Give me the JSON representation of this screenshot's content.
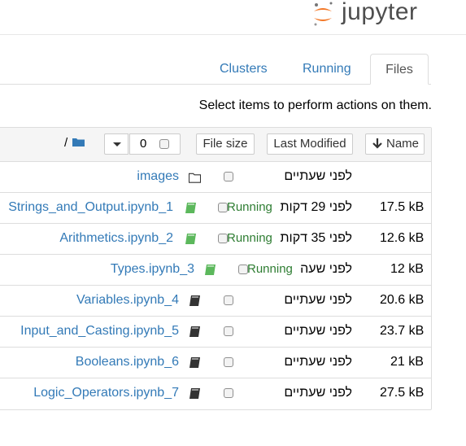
{
  "logo": {
    "text": "jupyter"
  },
  "tabs": {
    "clusters": "Clusters",
    "running": "Running",
    "files": "Files"
  },
  "instructions": "Select items to perform actions on them.",
  "header": {
    "name_label": "Name",
    "modified_label": "Last Modified",
    "size_label": "File size",
    "selected_count": "0",
    "breadcrumb": "/"
  },
  "rows": [
    {
      "name": "images",
      "type": "folder",
      "modified": "לפני שעתיים",
      "size": "",
      "running": ""
    },
    {
      "name": "Strings_and_Output.ipynb_1",
      "type": "notebook-running",
      "modified": "לפני 29 דקות",
      "size": "17.5 kB",
      "running": "Running"
    },
    {
      "name": "Arithmetics.ipynb_2",
      "type": "notebook-running",
      "modified": "לפני 35 דקות",
      "size": "12.6 kB",
      "running": "Running"
    },
    {
      "name": "Types.ipynb_3",
      "type": "notebook-running",
      "modified": "לפני שעה",
      "size": "12 kB",
      "running": "Running"
    },
    {
      "name": "Variables.ipynb_4",
      "type": "notebook",
      "modified": "לפני שעתיים",
      "size": "20.6 kB",
      "running": ""
    },
    {
      "name": "Input_and_Casting.ipynb_5",
      "type": "notebook",
      "modified": "לפני שעתיים",
      "size": "23.7 kB",
      "running": ""
    },
    {
      "name": "Booleans.ipynb_6",
      "type": "notebook",
      "modified": "לפני שעתיים",
      "size": "21 kB",
      "running": ""
    },
    {
      "name": "Logic_Operators.ipynb_7",
      "type": "notebook",
      "modified": "לפני שעתיים",
      "size": "27.5 kB",
      "running": ""
    }
  ],
  "colors": {
    "link": "#337ab7",
    "running": "#2e7d32",
    "logo_orange": "#f37726",
    "border": "#dddddd"
  }
}
